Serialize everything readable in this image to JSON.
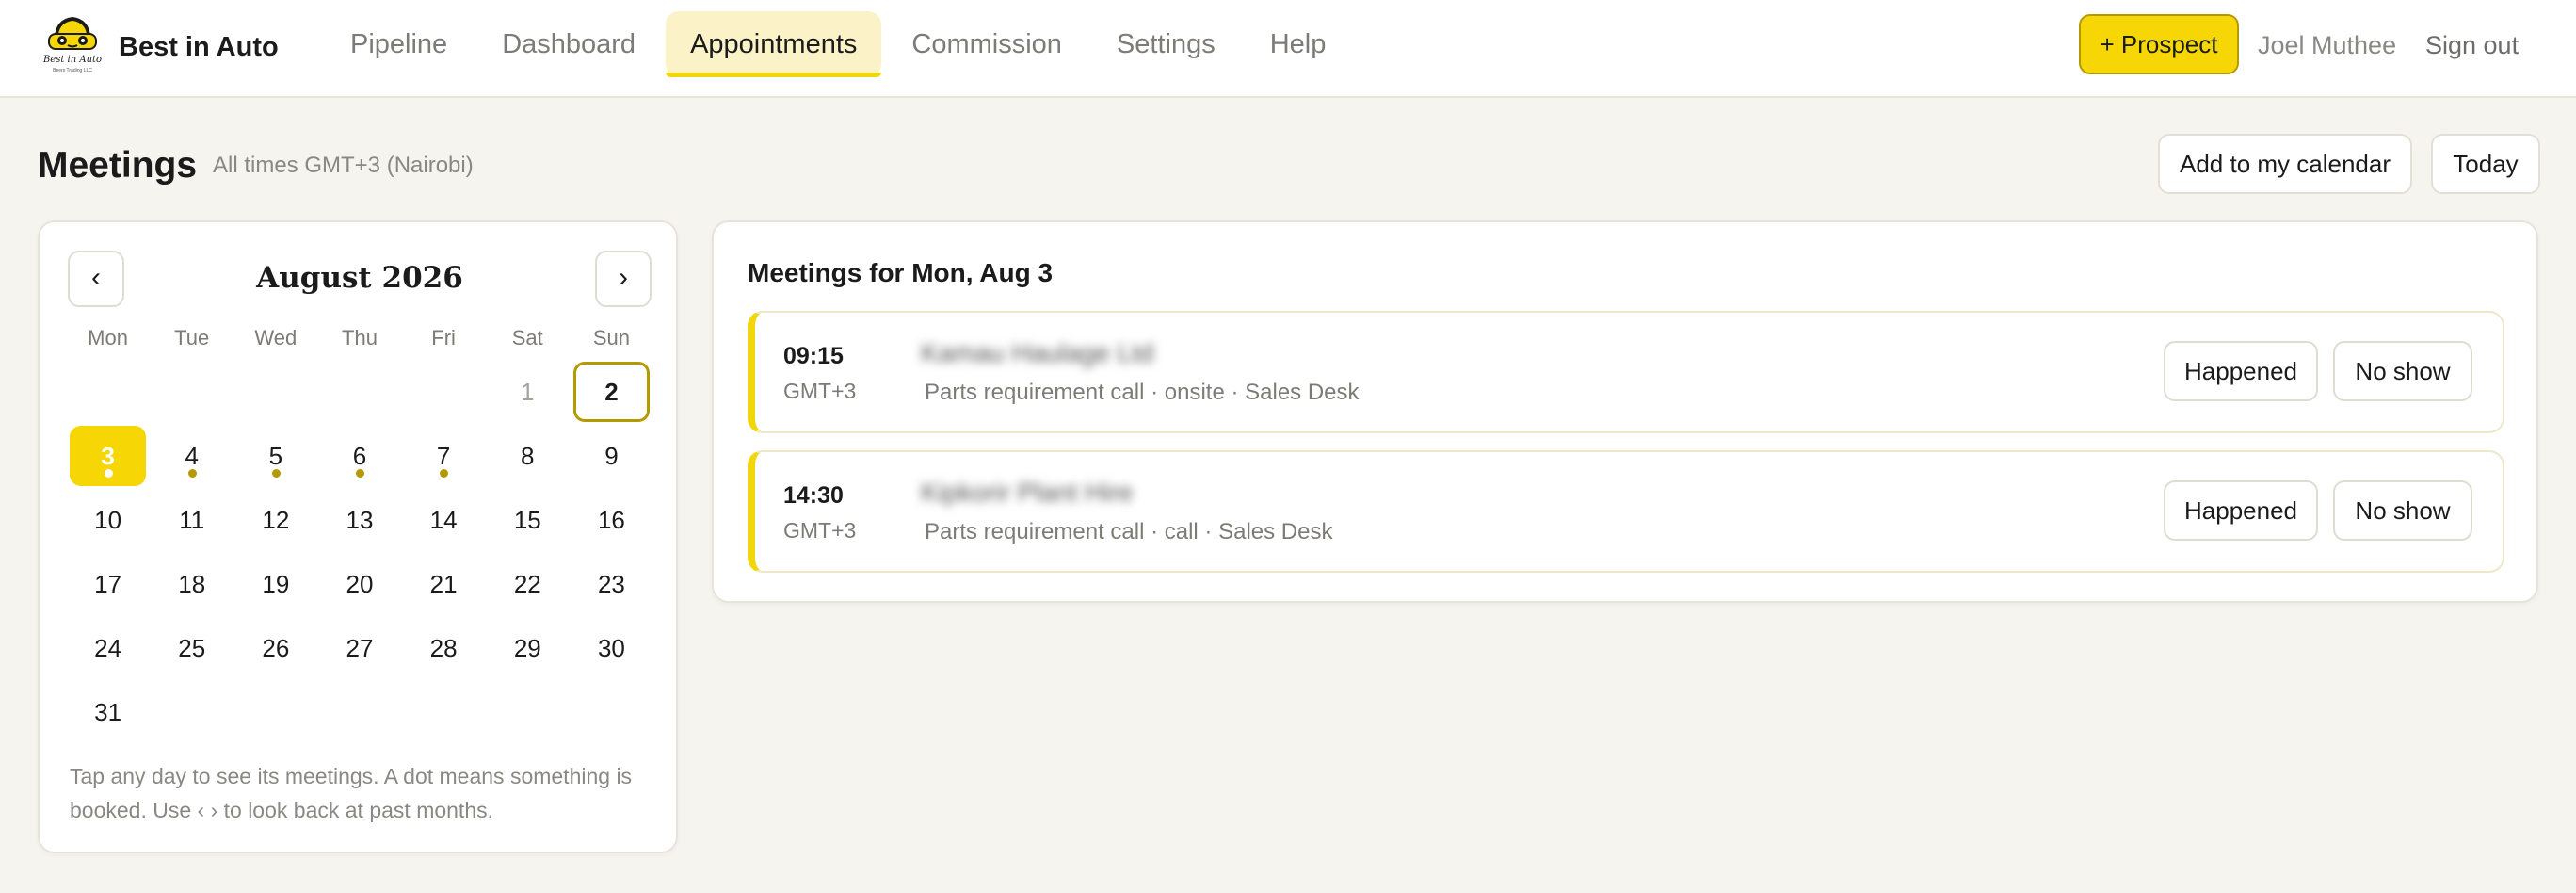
{
  "header": {
    "logo_caption": "Best in Auto",
    "logo_subcaption": "Beers Trading LLC",
    "brand": "Best in Auto",
    "nav": [
      {
        "label": "Pipeline",
        "active": false
      },
      {
        "label": "Dashboard",
        "active": false
      },
      {
        "label": "Appointments",
        "active": true
      },
      {
        "label": "Commission",
        "active": false
      },
      {
        "label": "Settings",
        "active": false
      },
      {
        "label": "Help",
        "active": false
      }
    ],
    "prospect_label": "+ Prospect",
    "user_name": "Joel Muthee",
    "sign_out_label": "Sign out"
  },
  "page": {
    "title": "Meetings",
    "subtitle": "All times GMT+3 (Nairobi)",
    "add_calendar_label": "Add to my calendar",
    "today_label": "Today"
  },
  "calendar": {
    "prev_label": "‹",
    "next_label": "›",
    "month_label": "August 2026",
    "weekdays": [
      "Mon",
      "Tue",
      "Wed",
      "Thu",
      "Fri",
      "Sat",
      "Sun"
    ],
    "weeks": [
      [
        null,
        null,
        null,
        null,
        null,
        {
          "day": "1",
          "muted": true
        },
        {
          "day": "2",
          "today": true
        }
      ],
      [
        {
          "day": "3",
          "selected": true,
          "dot": true
        },
        {
          "day": "4",
          "dot": true
        },
        {
          "day": "5",
          "dot": true
        },
        {
          "day": "6",
          "dot": true
        },
        {
          "day": "7",
          "dot": true
        },
        {
          "day": "8"
        },
        {
          "day": "9"
        }
      ],
      [
        {
          "day": "10"
        },
        {
          "day": "11"
        },
        {
          "day": "12"
        },
        {
          "day": "13"
        },
        {
          "day": "14"
        },
        {
          "day": "15"
        },
        {
          "day": "16"
        }
      ],
      [
        {
          "day": "17"
        },
        {
          "day": "18"
        },
        {
          "day": "19"
        },
        {
          "day": "20"
        },
        {
          "day": "21"
        },
        {
          "day": "22"
        },
        {
          "day": "23"
        }
      ],
      [
        {
          "day": "24"
        },
        {
          "day": "25"
        },
        {
          "day": "26"
        },
        {
          "day": "27"
        },
        {
          "day": "28"
        },
        {
          "day": "29"
        },
        {
          "day": "30"
        }
      ],
      [
        {
          "day": "31"
        },
        null,
        null,
        null,
        null,
        null,
        null
      ]
    ],
    "help_text": "Tap any day to see its meetings. A dot means something is booked. Use ‹ › to look back at past months."
  },
  "meetings": {
    "heading": "Meetings for Mon, Aug 3",
    "items": [
      {
        "time": "09:15",
        "tz": "GMT+3",
        "name": "Kamau Haulage Ltd",
        "detail": "Parts requirement call · onsite · Sales Desk",
        "happened_label": "Happened",
        "no_show_label": "No show"
      },
      {
        "time": "14:30",
        "tz": "GMT+3",
        "name": "Kipkorir Plant Hire",
        "detail": "Parts requirement call · call · Sales Desk",
        "happened_label": "Happened",
        "no_show_label": "No show"
      }
    ]
  },
  "colors": {
    "accent": "#f6d705",
    "accent_dark": "#b49a00",
    "background": "#f6f4ef"
  }
}
